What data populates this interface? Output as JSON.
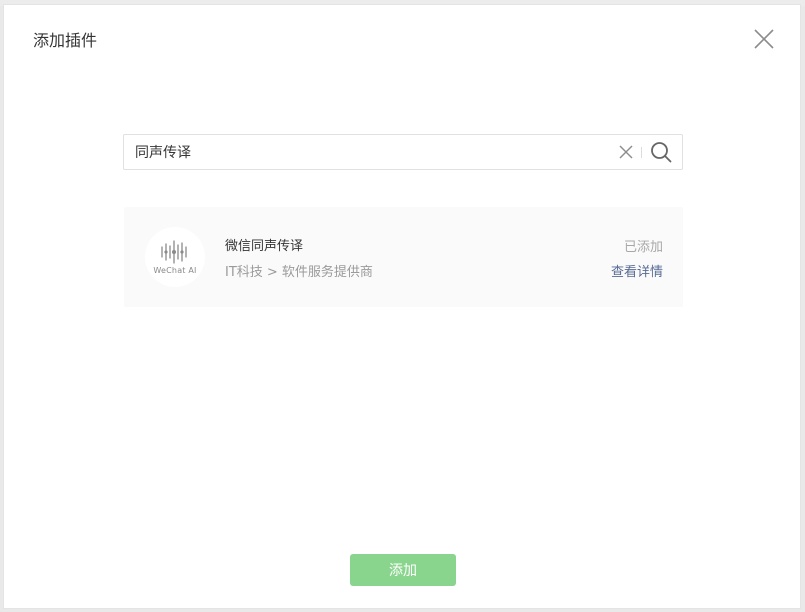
{
  "dialog": {
    "title": "添加插件"
  },
  "search": {
    "value": "同声传译",
    "clear_icon": "close-icon",
    "search_icon": "search-icon"
  },
  "result": {
    "avatar_caption": "WeChat AI",
    "name": "微信同声传译",
    "category": "IT科技 > 软件服务提供商",
    "status": "已添加",
    "detail_link": "查看详情"
  },
  "footer": {
    "add_label": "添加"
  },
  "colors": {
    "primary_button": "#8ad58e",
    "link": "#576b95",
    "card_background": "#fafafa"
  }
}
